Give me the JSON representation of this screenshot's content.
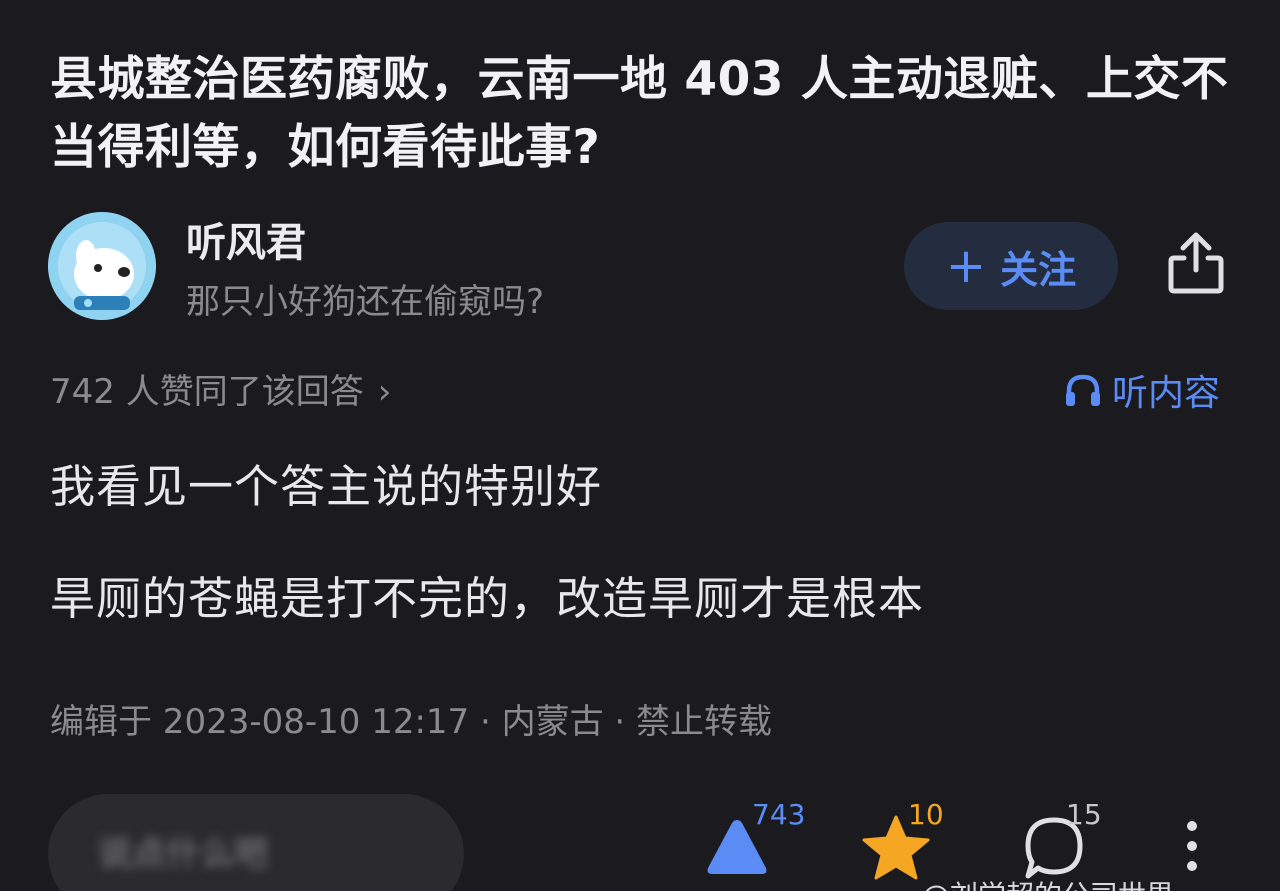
{
  "question": {
    "title": "县城整治医药腐败，云南一地 403 人主动退赃、上交不当得利等，如何看待此事?"
  },
  "author": {
    "name": "听风君",
    "bio": "那只小好狗还在偷窥吗?",
    "follow_label": "关注",
    "follow_icon": "plus-icon",
    "avatar_icon": "dog-astronaut-avatar"
  },
  "answer": {
    "upvote_summary": "742 人赞同了该回答",
    "listen_label": "听内容",
    "paragraphs": [
      "我看见一个答主说的特别好",
      "旱厕的苍蝇是打不完的，改造旱厕才是根本"
    ],
    "edit_meta": "编辑于 2023-08-10 12:17 · 内蒙古 · 禁止转载"
  },
  "actions": {
    "comment_placeholder": "说点什么吧",
    "upvote_count": "743",
    "favorite_count": "10",
    "comment_count": "15"
  },
  "colors": {
    "background": "#1b1b1f",
    "accent_blue": "#5b8cf5",
    "star_orange": "#f5a623",
    "muted_text": "#8a8a90"
  },
  "watermark": "@刘学超的公司世界"
}
